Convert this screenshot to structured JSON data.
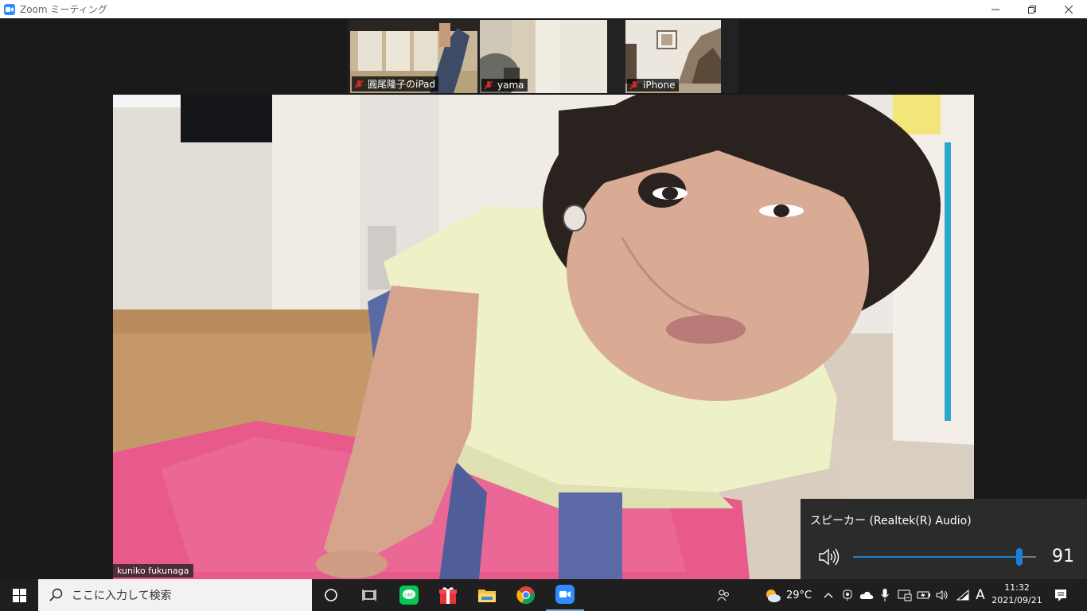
{
  "window": {
    "title": "Zoom ミーティング",
    "controls": [
      "minimize",
      "restore",
      "close"
    ]
  },
  "participants_strip": [
    {
      "name": "圓尾隆子のiPad",
      "muted": true
    },
    {
      "name": "yama",
      "muted": true
    },
    {
      "name": "iPhone",
      "muted": true
    }
  ],
  "active_speaker": {
    "name": "kuniko fukunaga"
  },
  "volume_flyout": {
    "device": "スピーカー (Realtek(R) Audio)",
    "volume": 91,
    "accent_color": "#1b7fd9"
  },
  "taskbar": {
    "search_placeholder": "ここに入力して検索",
    "pinned_apps": [
      "cortana-icon",
      "task-view-icon",
      "line-icon",
      "gift-icon",
      "file-explorer-icon",
      "chrome-icon",
      "zoom-icon"
    ],
    "weather": "29°C",
    "ime": "A",
    "time": "11:32",
    "date": "2021/09/21"
  }
}
